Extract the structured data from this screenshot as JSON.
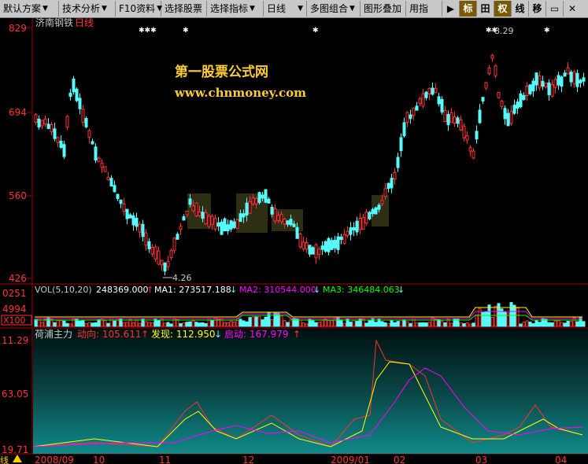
{
  "toolbar": {
    "items": [
      {
        "label": "默认方案",
        "dropdown": true
      },
      {
        "label": "技术分析",
        "dropdown": true
      },
      {
        "label": "F10资料",
        "dropdown": true
      },
      {
        "label": "选择股票",
        "dropdown": false
      },
      {
        "label": "选择指标",
        "dropdown": true
      },
      {
        "label": "日线",
        "dropdown": true
      },
      {
        "label": "多图组合",
        "dropdown": true
      },
      {
        "label": "图形叠加",
        "dropdown": false
      },
      {
        "label": "用指",
        "dropdown": false
      }
    ],
    "buttons": [
      {
        "name": "play",
        "label": "▶"
      },
      {
        "name": "mark",
        "label": "标"
      },
      {
        "name": "crosshair",
        "label": "田"
      },
      {
        "name": "weight",
        "label": "权"
      },
      {
        "name": "line",
        "label": "线"
      },
      {
        "name": "move",
        "label": "移"
      },
      {
        "name": "window",
        "label": "▭"
      },
      {
        "name": "close",
        "label": "✕"
      }
    ]
  },
  "main": {
    "stock_name": "济南钢铁",
    "period": "日线",
    "watermark_title": "第一股票公式网",
    "watermark_url": "www.chnmoney.com",
    "price_axis": [
      "829",
      "694",
      "560",
      "426"
    ],
    "high_label": "8.29",
    "low_label": "4.26"
  },
  "volume": {
    "header": "VOL(5,10,20)",
    "vol": "248369.000",
    "ma1_label": "MA1: 273517.188",
    "ma2_label": "MA2: 310544.000",
    "ma3_label": "MA3: 346484.063",
    "axis_top": "0251",
    "axis_mid": "4994",
    "axis_unit": "X100"
  },
  "indicator": {
    "name": "荷浦主力",
    "l1": "动向: 105.611",
    "l2": "发现: 112.950",
    "l3": "启动: 167.979",
    "axis": [
      "11.29",
      "63.05",
      "19.71"
    ]
  },
  "dates": [
    "2008/09",
    "10",
    "11",
    "12",
    "2009/01",
    "02",
    "03",
    "04"
  ],
  "colors": {
    "up": "#ff3232",
    "down": "#54fcfc",
    "axis": "#a00000",
    "yellow": "#ffff00",
    "magenta": "#ff00ff",
    "green": "#00ff00",
    "text_red": "#ff3232"
  },
  "chart_data": {
    "type": "candlestick",
    "title": "济南钢铁 日线",
    "y_axis_ticks": [
      829,
      694,
      560,
      426
    ],
    "x_labels": [
      "2008/09",
      "10",
      "11",
      "12",
      "2009/01",
      "02",
      "03",
      "04"
    ],
    "y_range": [
      426,
      829
    ],
    "high_marker": 8.29,
    "low_marker": 4.26,
    "volume_panel": {
      "series": [
        {
          "name": "VOL",
          "value": 248369.0
        },
        {
          "name": "MA1",
          "value": 273517.188
        },
        {
          "name": "MA2",
          "value": 310544.0
        },
        {
          "name": "MA3",
          "value": 346484.063
        }
      ]
    },
    "indicator_panel": {
      "name": "荷浦主力",
      "series": [
        {
          "name": "动向",
          "value": 105.611
        },
        {
          "name": "发现",
          "value": 112.95
        },
        {
          "name": "启动",
          "value": 167.979
        }
      ],
      "axis_ticks": [
        11.29,
        63.05,
        19.71
      ]
    }
  }
}
